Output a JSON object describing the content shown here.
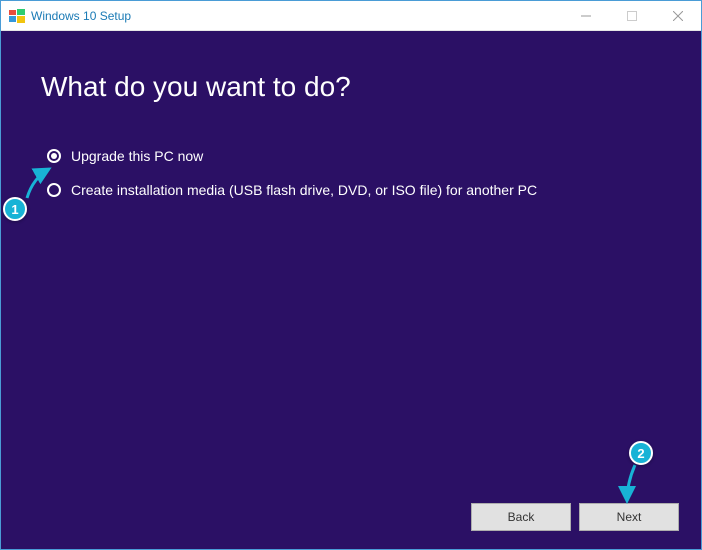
{
  "titlebar": {
    "title": "Windows 10 Setup"
  },
  "main": {
    "heading": "What do you want to do?",
    "options": [
      {
        "label": "Upgrade this PC now",
        "selected": true
      },
      {
        "label": "Create installation media (USB flash drive, DVD, or ISO file) for another PC",
        "selected": false
      }
    ]
  },
  "footer": {
    "back_label": "Back",
    "next_label": "Next"
  },
  "annotations": {
    "callout1": "1",
    "callout2": "2"
  }
}
